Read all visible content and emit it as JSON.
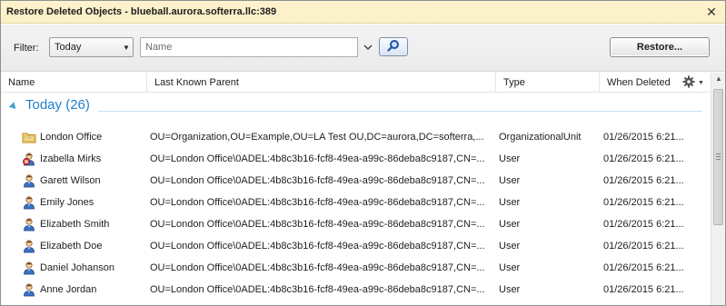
{
  "window": {
    "title": "Restore Deleted Objects - blueball.aurora.softerra.llc:389",
    "close_glyph": "✕"
  },
  "toolbar": {
    "filter_label": "Filter:",
    "filter_value": "Today",
    "name_placeholder": "Name",
    "restore_label": "Restore..."
  },
  "columns": {
    "name": "Name",
    "parent": "Last Known Parent",
    "type": "Type",
    "when": "When Deleted"
  },
  "group": {
    "label": "Today  (26)"
  },
  "rows": [
    {
      "name": "London Office",
      "parent": "OU=Organization,OU=Example,OU=LA Test OU,DC=aurora,DC=softerra,...",
      "type": "OrganizationalUnit",
      "when": "01/26/2015 6:21...",
      "icon": "folder-icon"
    },
    {
      "name": "Izabella Mirks",
      "parent": "OU=London Office\\0ADEL:4b8c3b16-fcf8-49ea-a99c-86deba8c9187,CN=...",
      "type": "User",
      "when": "01/26/2015 6:21...",
      "icon": "user-disabled-icon"
    },
    {
      "name": "Garett Wilson",
      "parent": "OU=London Office\\0ADEL:4b8c3b16-fcf8-49ea-a99c-86deba8c9187,CN=...",
      "type": "User",
      "when": "01/26/2015 6:21...",
      "icon": "user-icon"
    },
    {
      "name": "Emily Jones",
      "parent": "OU=London Office\\0ADEL:4b8c3b16-fcf8-49ea-a99c-86deba8c9187,CN=...",
      "type": "User",
      "when": "01/26/2015 6:21...",
      "icon": "user-icon"
    },
    {
      "name": "Elizabeth Smith",
      "parent": "OU=London Office\\0ADEL:4b8c3b16-fcf8-49ea-a99c-86deba8c9187,CN=...",
      "type": "User",
      "when": "01/26/2015 6:21...",
      "icon": "user-icon"
    },
    {
      "name": "Elizabeth Doe",
      "parent": "OU=London Office\\0ADEL:4b8c3b16-fcf8-49ea-a99c-86deba8c9187,CN=...",
      "type": "User",
      "when": "01/26/2015 6:21...",
      "icon": "user-icon"
    },
    {
      "name": "Daniel Johanson",
      "parent": "OU=London Office\\0ADEL:4b8c3b16-fcf8-49ea-a99c-86deba8c9187,CN=...",
      "type": "User",
      "when": "01/26/2015 6:21...",
      "icon": "user-icon"
    },
    {
      "name": "Anne Jordan",
      "parent": "OU=London Office\\0ADEL:4b8c3b16-fcf8-49ea-a99c-86deba8c9187,CN=...",
      "type": "User",
      "when": "01/26/2015 6:21...",
      "icon": "user-icon"
    }
  ],
  "colors": {
    "title_bg": "#fdf3cd",
    "group_text": "#1e7fc9",
    "accent": "#3a8bc7"
  }
}
